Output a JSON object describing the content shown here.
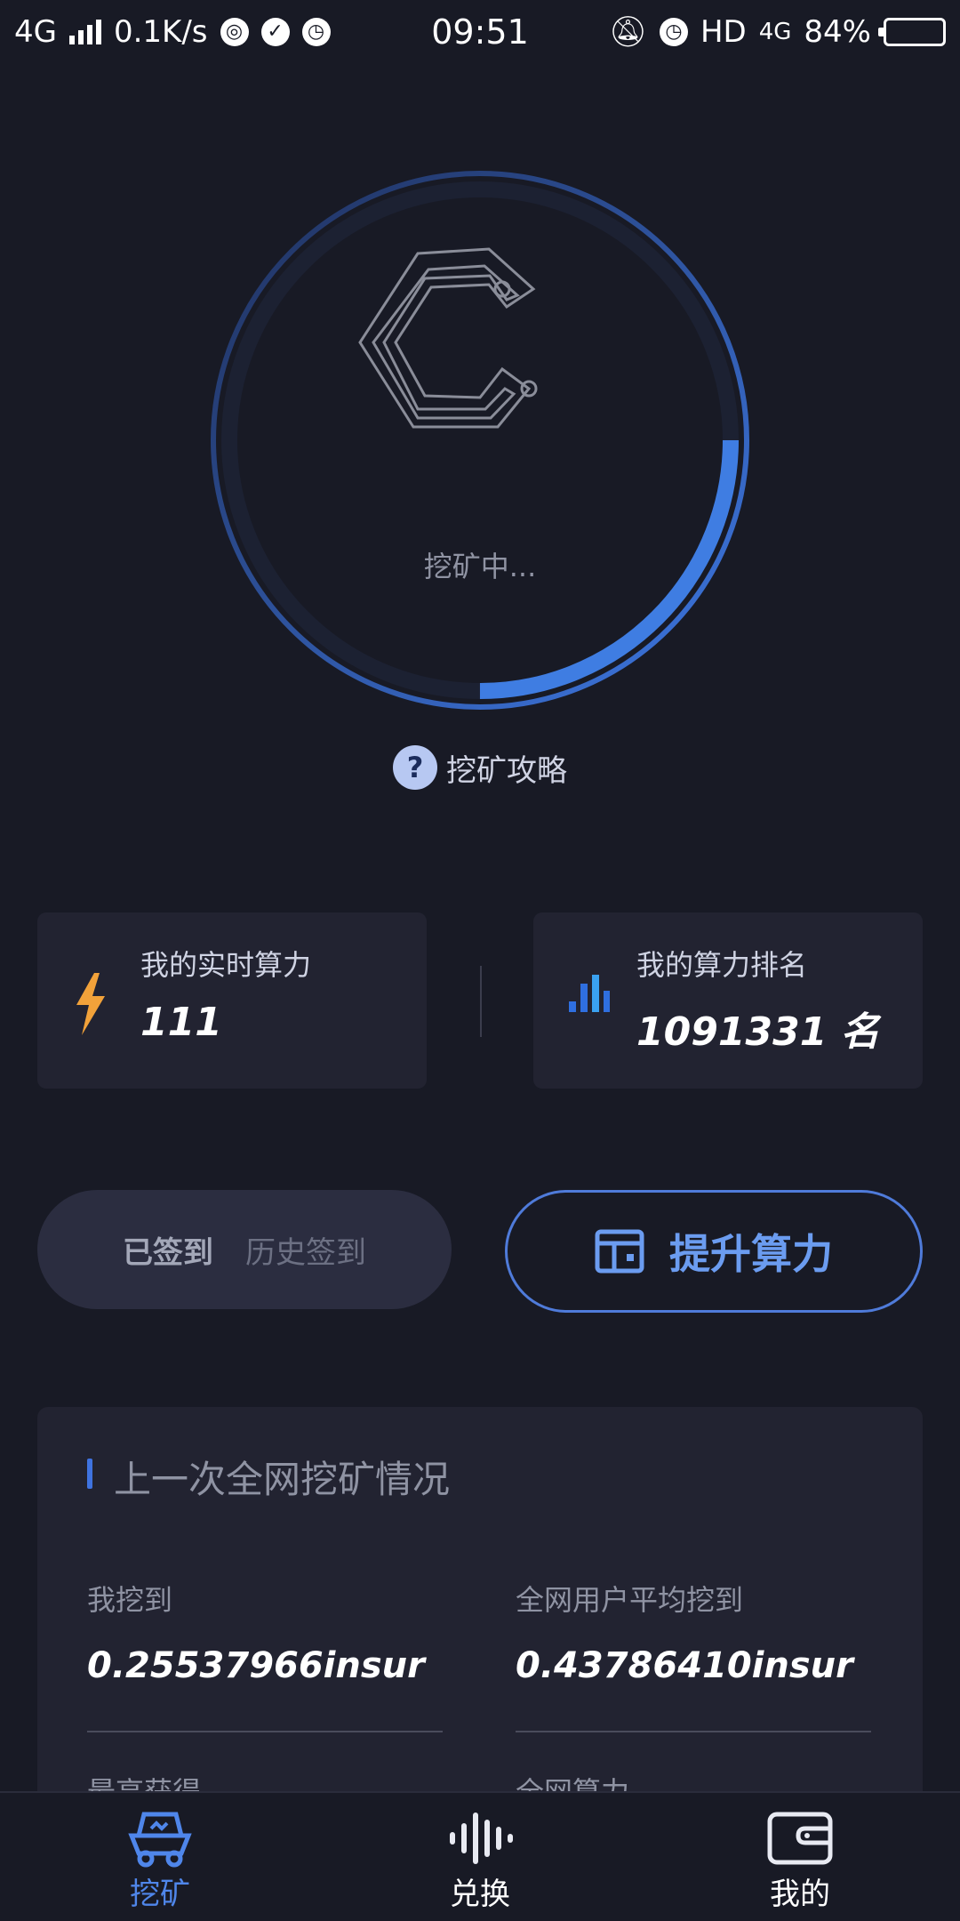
{
  "status_bar": {
    "network": "4G",
    "speed": "0.1K/s",
    "time": "09:51",
    "hd": "HD",
    "network_right": "4G",
    "battery": "84%"
  },
  "mining": {
    "status": "挖矿中...",
    "guide_label": "挖矿攻略",
    "progress": 0.25
  },
  "stats": {
    "realtime_label": "我的实时算力",
    "realtime_value": "111",
    "rank_label": "我的算力排名",
    "rank_value": "1091331 名"
  },
  "actions": {
    "signed_label": "已签到",
    "history_label": "历史签到",
    "boost_label": "提升算力"
  },
  "last_network": {
    "title": "上一次全网挖矿情况",
    "metrics": [
      {
        "label": "我挖到",
        "value": "0.25537966insur"
      },
      {
        "label": "全网用户平均挖到",
        "value": "0.43786410insur"
      },
      {
        "label": "最高获得",
        "value": ""
      },
      {
        "label": "全网算力",
        "value": ""
      }
    ]
  },
  "bottom_nav": {
    "items": [
      {
        "label": "挖矿",
        "icon": "mining-cart-icon",
        "active": true
      },
      {
        "label": "兑换",
        "icon": "exchange-wave-icon",
        "active": false
      },
      {
        "label": "我的",
        "icon": "wallet-icon",
        "active": false
      }
    ]
  },
  "colors": {
    "background": "#181a25",
    "card": "#222331",
    "accent": "#4f86ea",
    "lightning": "#f2a23a"
  }
}
